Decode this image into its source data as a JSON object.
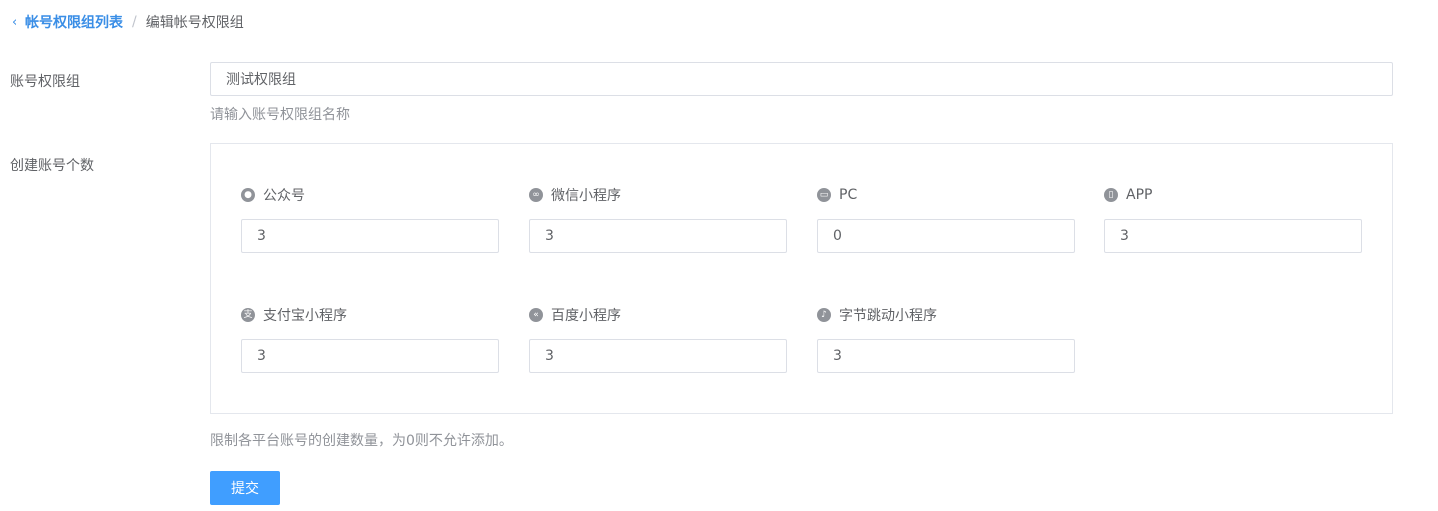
{
  "breadcrumb": {
    "parent": "帐号权限组列表",
    "separator": "/",
    "current": "编辑帐号权限组"
  },
  "form": {
    "group_label": "账号权限组",
    "group_value": "测试权限组",
    "group_hint": "请输入账号权限组名称",
    "count_label": "创建账号个数",
    "count_hint": "限制各平台账号的创建数量，为0则不允许添加。",
    "submit_label": "提交"
  },
  "platforms": [
    {
      "name": "公众号",
      "icon": "wechat-icon",
      "value": "3"
    },
    {
      "name": "微信小程序",
      "icon": "mini-program-icon",
      "value": "3"
    },
    {
      "name": "PC",
      "icon": "pc-icon",
      "value": "0"
    },
    {
      "name": "APP",
      "icon": "phone-icon",
      "value": "3"
    },
    {
      "name": "支付宝小程序",
      "icon": "alipay-icon",
      "value": "3"
    },
    {
      "name": "百度小程序",
      "icon": "baidu-icon",
      "value": "3"
    },
    {
      "name": "字节跳动小程序",
      "icon": "bytedance-icon",
      "value": "3"
    }
  ],
  "colors": {
    "primary": "#409eff",
    "link": "#3a8ee6",
    "border": "#dcdfe6",
    "icon": "#909399"
  }
}
